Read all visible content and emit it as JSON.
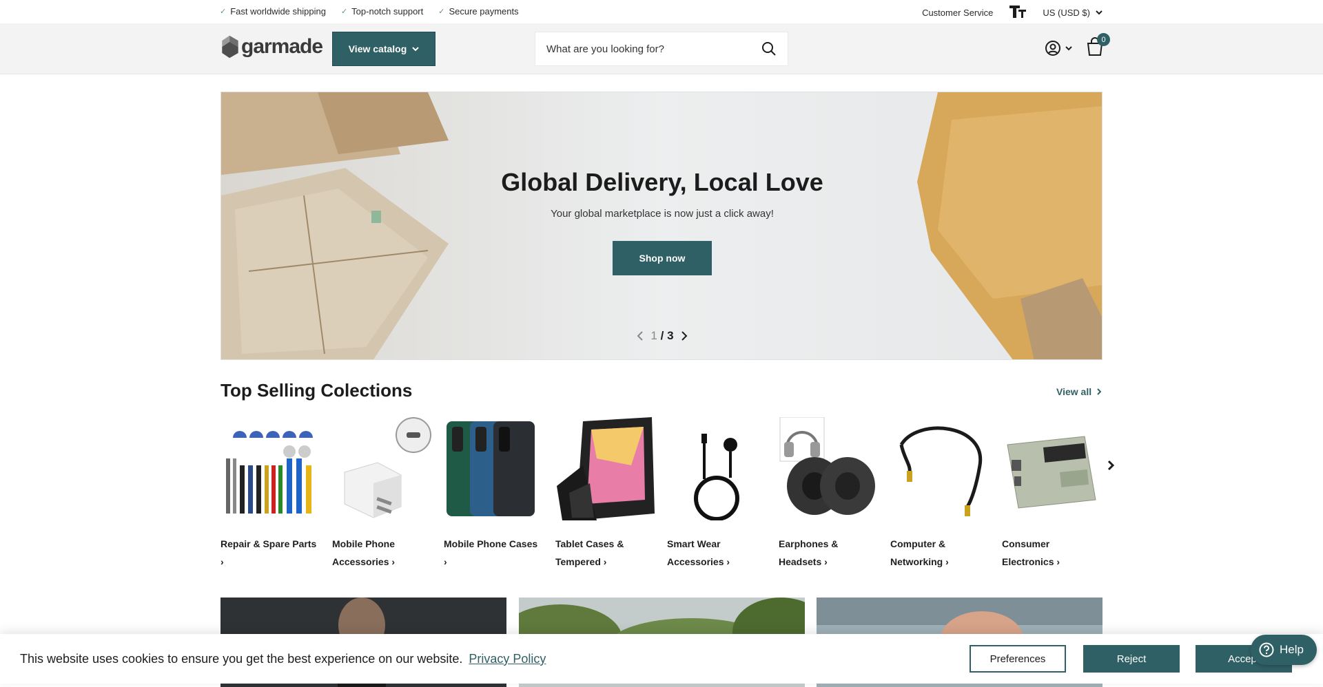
{
  "announcement": {
    "items": [
      "Fast worldwide shipping",
      "Top-notch support",
      "Secure payments"
    ],
    "customer_service": "Customer Service",
    "currency": "US (USD $)"
  },
  "header": {
    "logo_text": "garmade",
    "catalog_label": "View catalog",
    "search_placeholder": "What are you looking for?",
    "cart_count": "0"
  },
  "hero": {
    "title": "Global Delivery, Local Love",
    "subtitle": "Your global marketplace is now just a click away!",
    "button": "Shop now",
    "page_current": "1",
    "page_sep": "/",
    "page_total": "3"
  },
  "collections": {
    "title": "Top Selling Colections",
    "view_all": "View all",
    "items": [
      {
        "label": "Repair & Spare Parts",
        "icon": "repair-tools"
      },
      {
        "label": "Mobile Phone Accessories",
        "icon": "charger"
      },
      {
        "label": "Mobile Phone Cases",
        "icon": "phone-cases"
      },
      {
        "label": "Tablet Cases & Tempered",
        "icon": "tablet-case"
      },
      {
        "label": "Smart Wear Accessories",
        "icon": "watch-charger"
      },
      {
        "label": "Earphones & Headsets",
        "icon": "ear-pads"
      },
      {
        "label": "Computer & Networking",
        "icon": "audio-cable"
      },
      {
        "label": "Consumer Electronics",
        "icon": "battery"
      }
    ]
  },
  "cookie": {
    "text": "This website uses cookies to ensure you get the best experience on our website.",
    "link": "Privacy Policy",
    "preferences": "Preferences",
    "reject": "Reject",
    "accept": "Accept"
  },
  "help": {
    "label": "Help"
  },
  "colors": {
    "accent": "#2f6065",
    "check": "#5f8f7e"
  }
}
